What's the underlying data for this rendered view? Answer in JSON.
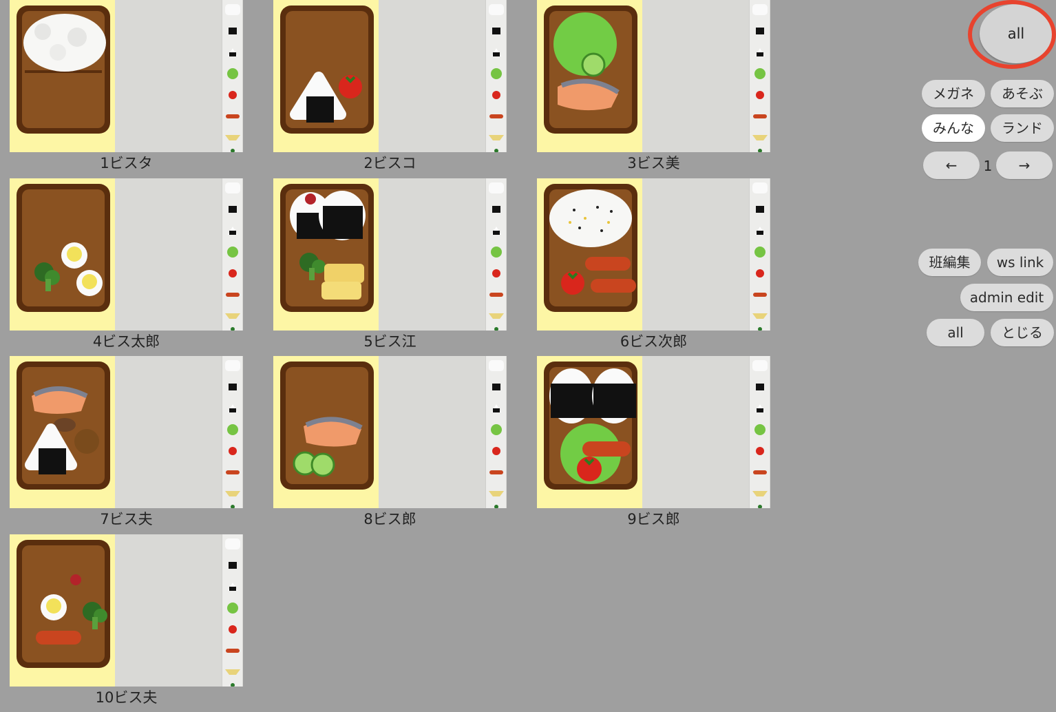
{
  "cards": [
    {
      "label": "1ビスタ"
    },
    {
      "label": "2ビスコ"
    },
    {
      "label": "3ビス美"
    },
    {
      "label": "4ビス太郎"
    },
    {
      "label": "5ビス江"
    },
    {
      "label": "6ビス次郎"
    },
    {
      "label": "7ビス夫"
    },
    {
      "label": "8ビス郎"
    },
    {
      "label": "9ビス郎"
    },
    {
      "label": "10ビス夫"
    }
  ],
  "controls": {
    "all_big": "all",
    "megane": "メガネ",
    "asobu": "あそぶ",
    "minna": "みんな",
    "land": "ランド",
    "prev_icon": "←",
    "page_number": "1",
    "next_icon": "→",
    "han_edit": "班編集",
    "ws_link": "ws link",
    "admin_edit": "admin edit",
    "all_small": "all",
    "close": "とじる"
  },
  "colors": {
    "background": "#9f9f9f",
    "highlight_ring": "#e8432e",
    "card_yellow": "#fdf6a5",
    "bento_brown": "#8a5221"
  }
}
